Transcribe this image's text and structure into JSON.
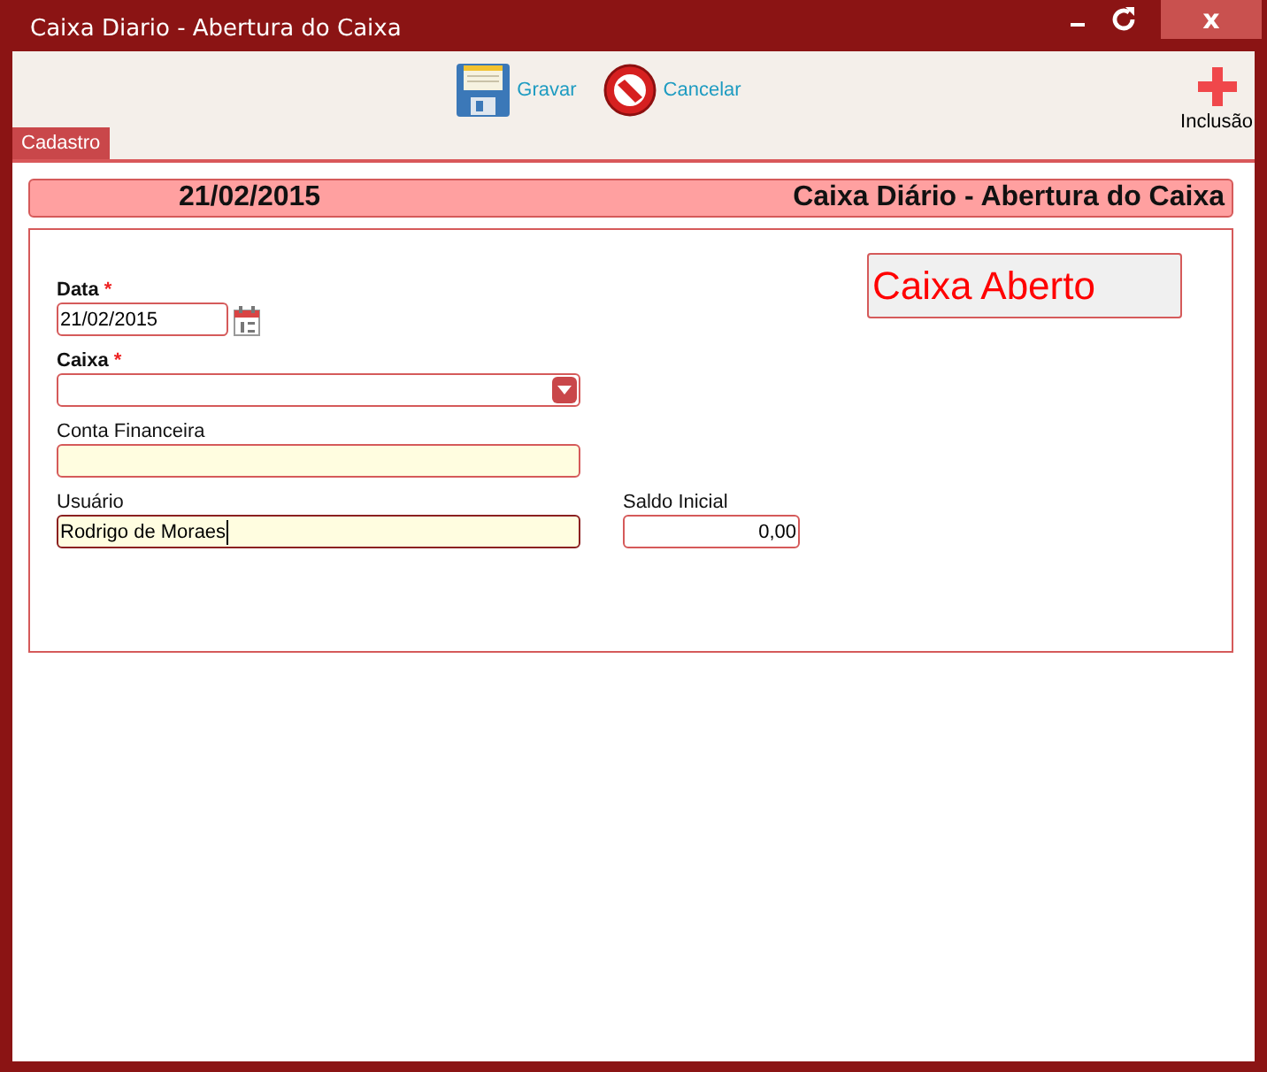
{
  "window": {
    "title": "Caixa Diario - Abertura do Caixa",
    "controls": [
      {
        "kind": "minimize"
      },
      {
        "kind": "refresh"
      },
      {
        "kind": "close",
        "label": "x"
      }
    ]
  },
  "toolbar": {
    "buttons": [
      {
        "kind": "save",
        "label": "Gravar"
      },
      {
        "kind": "cancel",
        "label": "Cancelar"
      }
    ],
    "side_button": {
      "kind": "add",
      "label": "Inclusão"
    }
  },
  "tabs": [
    {
      "label": "Cadastro",
      "selected": true
    }
  ],
  "header": {
    "date": "21/02/2015",
    "title": "Caixa Diário - Abertura do Caixa"
  },
  "status_badge": "Caixa Aberto",
  "form": {
    "rows": [
      [
        {
          "kind": "date",
          "label": "Data",
          "required_mark": "*",
          "value": "21/02/2015",
          "highlighted": false,
          "focused": false
        }
      ],
      [
        {
          "kind": "select",
          "label": "Caixa",
          "required_mark": "*",
          "highlighted": false,
          "focused": false
        }
      ],
      [
        {
          "kind": "text",
          "label": "Conta Financeira",
          "highlighted": true,
          "focused": false
        }
      ],
      [
        {
          "kind": "text",
          "label": "Usuário",
          "value": "Rodrigo de Moraes",
          "highlighted": true,
          "focused": true
        },
        {
          "kind": "number",
          "label": "Saldo Inicial",
          "value": "0,00",
          "highlighted": false,
          "focused": false
        }
      ]
    ]
  }
}
